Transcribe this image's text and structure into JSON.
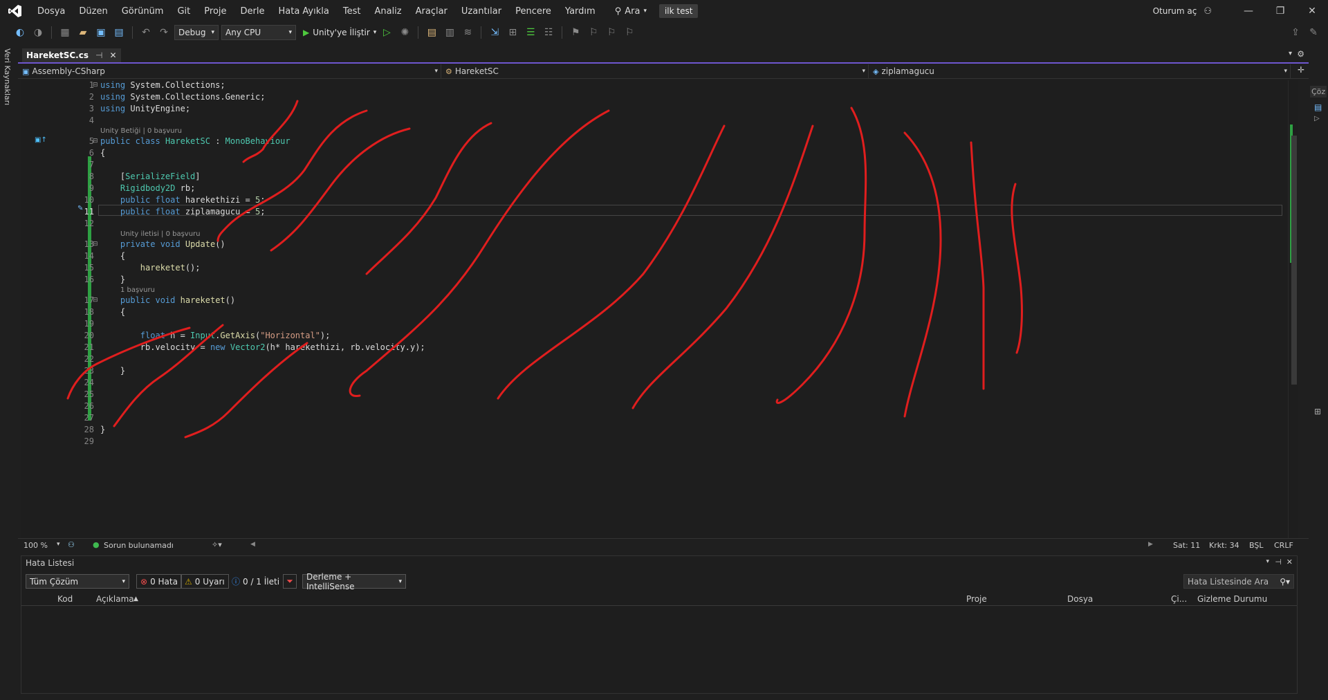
{
  "menu": [
    "Dosya",
    "Düzen",
    "Görünüm",
    "Git",
    "Proje",
    "Derle",
    "Hata Ayıkla",
    "Test",
    "Analiz",
    "Araçlar",
    "Uzantılar",
    "Pencere",
    "Yardım"
  ],
  "search_label": "Ara",
  "solution_name": "ilk test",
  "sign_in": "Oturum aç",
  "toolbar": {
    "config": "Debug",
    "platform": "Any CPU",
    "attach": "Unity'ye İliştir"
  },
  "left_strip_label": "Veri Kaynakları",
  "right_strip_label": "Çöz",
  "tab": {
    "title": "HareketSC.cs",
    "pin": "⊣",
    "close": "✕"
  },
  "nav": {
    "project": "Assembly-CSharp",
    "class": "HareketSC",
    "member": "ziplamagucu"
  },
  "lens": {
    "unity_script": "Unity Betiği | 0 başvuru",
    "unity_message": "Unity iletisi | 0 başvuru",
    "one_ref": "1 başvuru"
  },
  "line_numbers": [
    "1",
    "2",
    "3",
    "4",
    "5",
    "6",
    "7",
    "8",
    "9",
    "10",
    "11",
    "12",
    "13",
    "14",
    "15",
    "16",
    "17",
    "18",
    "19",
    "20",
    "21",
    "22",
    "23",
    "24",
    "25",
    "26",
    "27",
    "28",
    "29"
  ],
  "current_line": "11",
  "status": {
    "zoom": "100 %",
    "issues": "Sorun bulunamadı",
    "line": "Sat: 11",
    "col": "Krkt: 34",
    "mode": "BŞL",
    "eol": "CRLF"
  },
  "error_list": {
    "title": "Hata Listesi",
    "scope": "Tüm Çözüm",
    "errors": "0 Hata",
    "warnings": "0 Uyarı",
    "messages": "0 / 1 İleti",
    "build_filter": "Derleme + IntelliSense",
    "search_placeholder": "Hata Listesinde Ara",
    "columns": [
      "Kod",
      "Açıklama",
      "Proje",
      "Dosya",
      "Çi...",
      "Gizleme Durumu"
    ]
  },
  "colors": {
    "accent": "#6e56cf",
    "change_bar": "#2ea043",
    "annotation": "#e01e1e"
  }
}
